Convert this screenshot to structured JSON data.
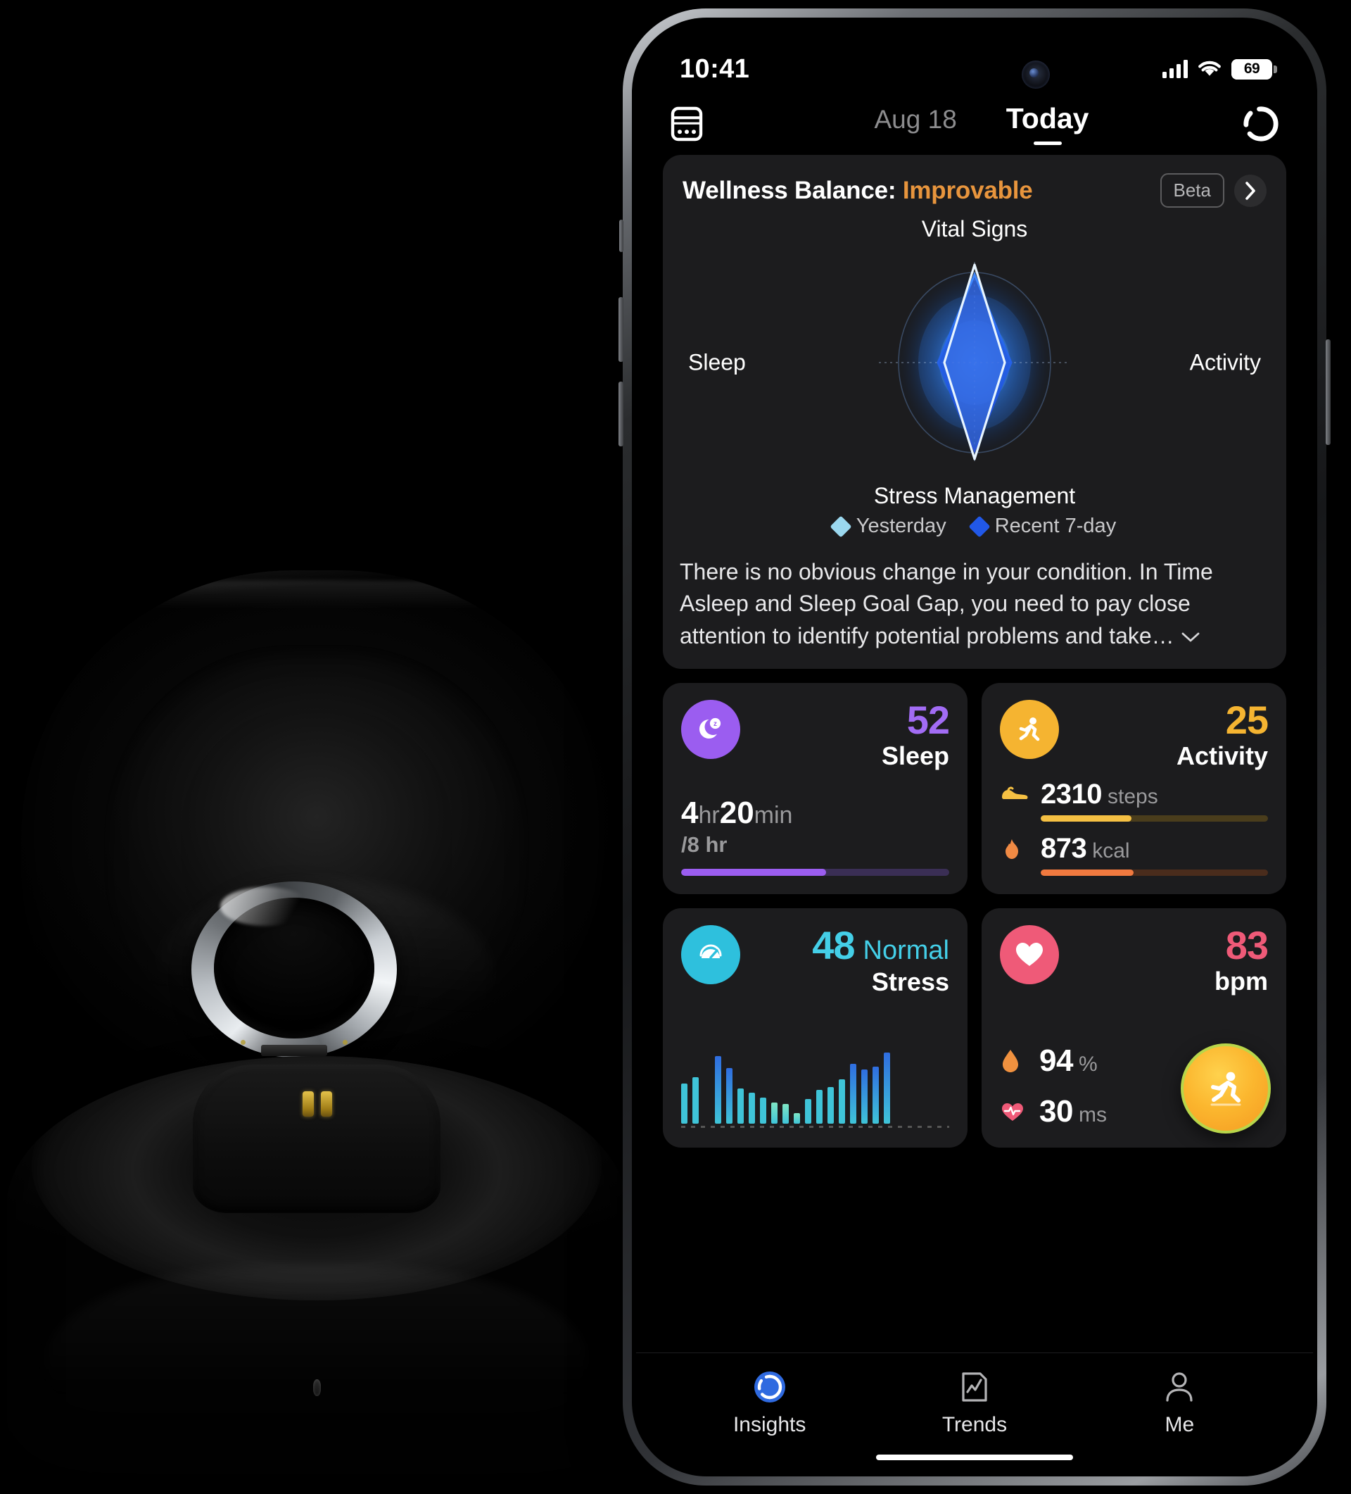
{
  "status_bar": {
    "time": "10:41",
    "battery_level": "69",
    "signal_icon": "cellular-signal-icon",
    "wifi_icon": "wifi-icon",
    "battery_icon": "battery-icon"
  },
  "header": {
    "calendar_icon": "calendar-icon",
    "prev_date": "Aug 18",
    "current_tab": "Today",
    "sync_icon": "sync-refresh-icon"
  },
  "wellness": {
    "title_prefix": "Wellness Balance: ",
    "title_value": "Improvable",
    "value_color": "#e8953d",
    "beta_label": "Beta",
    "chevron_icon": "chevron-right-icon",
    "description": "There is no obvious change in your condition. In Time Asleep and Sleep Goal Gap, you need to pay close attention to identify potential problems and take…",
    "expand_icon": "chevron-down-icon"
  },
  "chart_data": {
    "type": "radar",
    "title": "Wellness Balance",
    "categories": [
      "Vital Signs",
      "Activity",
      "Stress Management",
      "Sleep"
    ],
    "series": [
      {
        "name": "Yesterday",
        "color": "#9bd8ef",
        "values": [
          96,
          28,
          94,
          26
        ]
      },
      {
        "name": "Recent 7-day",
        "color": "#2158e8",
        "values": [
          84,
          34,
          82,
          32
        ]
      }
    ],
    "rmax": 100,
    "grid": true,
    "legend_position": "bottom"
  },
  "metrics": {
    "sleep": {
      "icon": "moon-sleep-icon",
      "icon_bg": "#9b5df0",
      "score": "52",
      "score_color": "#a26cf5",
      "name": "Sleep",
      "duration_hours": "4",
      "duration_hours_unit": "hr",
      "duration_minutes": "20",
      "duration_minutes_unit": "min",
      "goal": "/8 hr",
      "progress_percent": 54,
      "bar_color": "#9b5df0",
      "bar_track": "#3a2e55"
    },
    "activity": {
      "icon": "running-person-icon",
      "icon_bg": "#f5b431",
      "score": "25",
      "score_color": "#f5b431",
      "name": "Activity",
      "rows": [
        {
          "icon": "sneaker-icon",
          "icon_color": "#f5c043",
          "value": "2310",
          "unit": "steps",
          "progress_percent": 40,
          "bar_color": "#f5c043",
          "bar_track": "#4a3d1c"
        },
        {
          "icon": "flame-icon",
          "icon_color": "#f08a44",
          "value": "873",
          "unit": "kcal",
          "progress_percent": 41,
          "bar_color": "#f0793f",
          "bar_track": "#4a2c1c"
        }
      ]
    },
    "stress": {
      "icon": "stress-gauge-icon",
      "icon_bg": "#2ec0dd",
      "score": "48",
      "state": "Normal",
      "score_color": "#44cfe8",
      "name": "Stress",
      "chart": {
        "type": "bar",
        "values": [
          52,
          60,
          0,
          88,
          72,
          46,
          40,
          34,
          28,
          26,
          14,
          32,
          44,
          48,
          58,
          78,
          70,
          74,
          92
        ],
        "ymax": 100,
        "color_low": "#7fe6c4",
        "color_mid": "#3fc4d8",
        "color_high": "#2f6de0"
      }
    },
    "heart": {
      "icon": "heart-icon",
      "icon_bg": "#ef5a78",
      "score": "83",
      "score_color": "#ef5a78",
      "name": "bpm",
      "rows": [
        {
          "icon": "blood-oxygen-drop-icon",
          "icon_color": "#f0913f",
          "value": "94",
          "unit": "%"
        },
        {
          "icon": "heart-pulse-icon",
          "icon_color": "#ef5a78",
          "value": "30",
          "unit": "ms"
        }
      ],
      "fab": {
        "icon": "workout-running-icon",
        "bg": "#fbb62e",
        "ring": "#b8d64a"
      }
    }
  },
  "tab_bar": {
    "tabs": [
      {
        "label": "Insights",
        "icon": "insights-ring-icon",
        "active": true
      },
      {
        "label": "Trends",
        "icon": "trends-chart-icon",
        "active": false
      },
      {
        "label": "Me",
        "icon": "person-profile-icon",
        "active": false
      }
    ]
  },
  "product": {
    "name": "smart-ring-charging-case"
  }
}
